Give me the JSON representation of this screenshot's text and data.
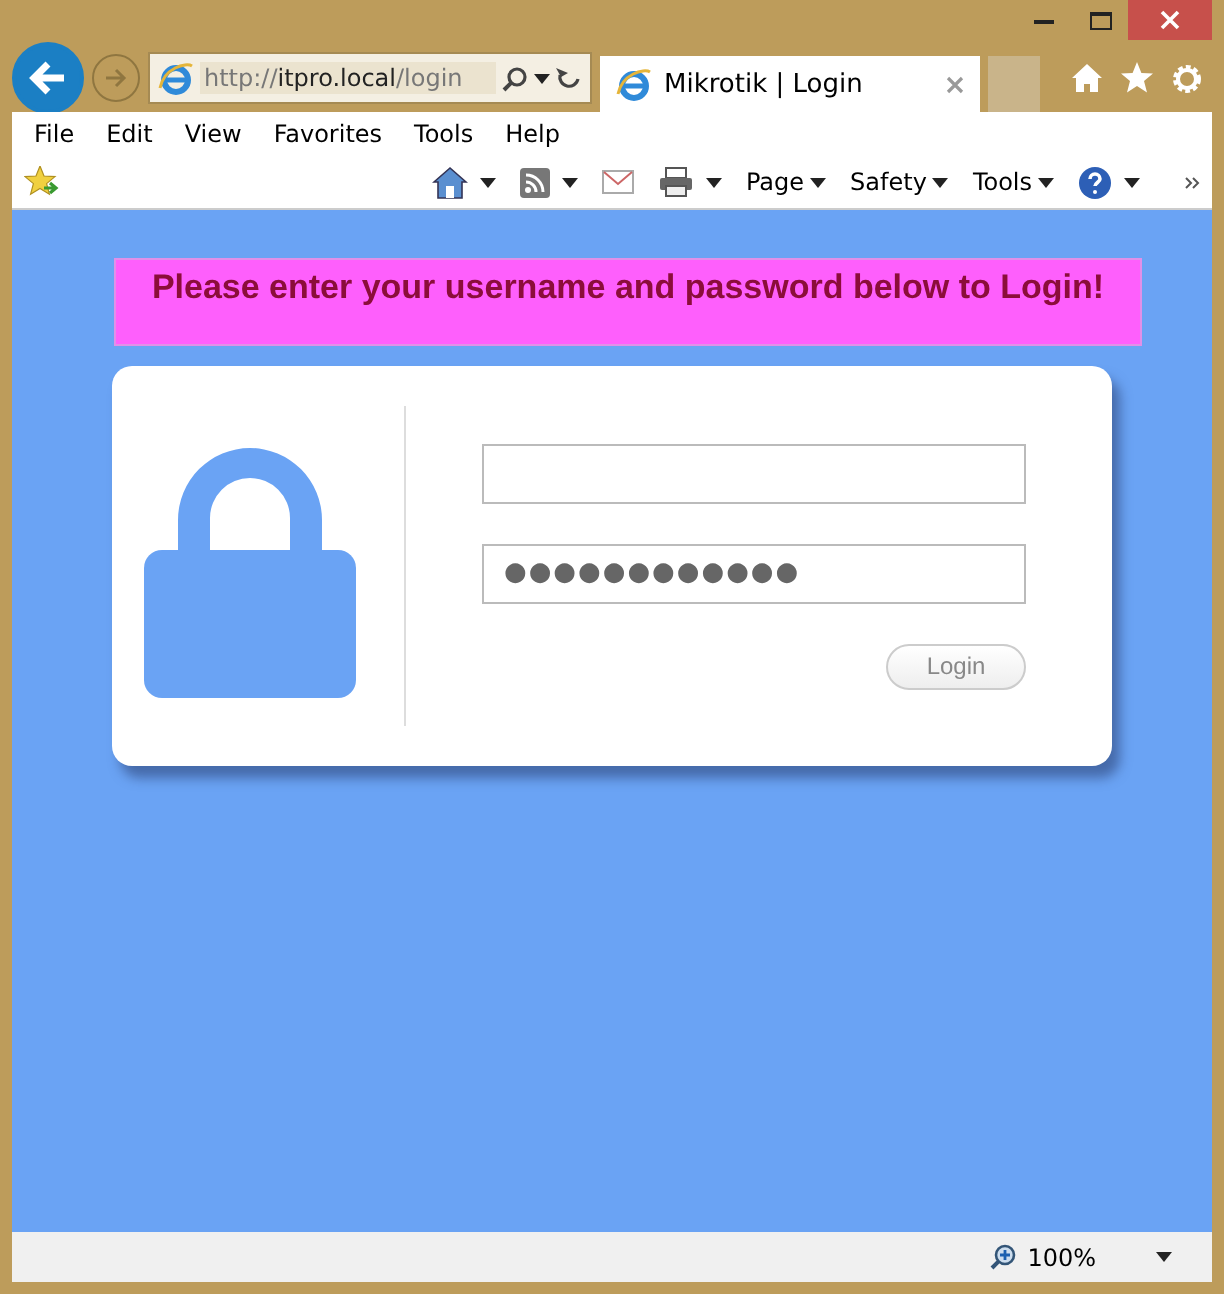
{
  "browser": {
    "address": {
      "scheme": "http://",
      "host": "itpro.local",
      "path": "/login"
    },
    "tab": {
      "title": "Mikrotik | Login",
      "selected": true
    },
    "menu": [
      "File",
      "Edit",
      "View",
      "Favorites",
      "Tools",
      "Help"
    ],
    "commands": [
      {
        "kind": "icon"
      },
      {
        "kind": "icon"
      },
      {
        "kind": "icon"
      },
      {
        "kind": "icon"
      },
      {
        "kind": "menu",
        "label": "Page"
      },
      {
        "kind": "menu",
        "label": "Safety"
      },
      {
        "kind": "menu",
        "label": "Tools"
      },
      {
        "kind": "icon"
      }
    ]
  },
  "page": {
    "banner": "Please enter your username and password below to Login!",
    "password": {
      "value": "●●●●●●●●●●●●"
    },
    "login_button": "Login"
  },
  "status_bar": {
    "zoom": "100%"
  }
}
